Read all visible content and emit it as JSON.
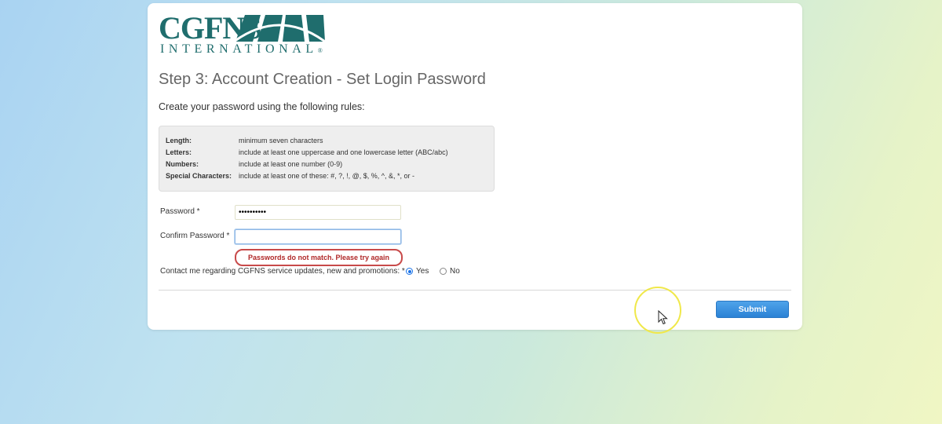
{
  "logo": {
    "text": "CGFNS",
    "subtext": "INTERNATIONAL",
    "registered": "®",
    "color": "#1f6d6d"
  },
  "page": {
    "title": "Step 3: Account Creation - Set Login Password",
    "intro": "Create your password using the following rules:"
  },
  "rules": [
    {
      "label": "Length:",
      "value": "minimum seven characters"
    },
    {
      "label": "Letters:",
      "value": "include at least one uppercase and one lowercase letter (ABC/abc)"
    },
    {
      "label": "Numbers:",
      "value": "include at least one number (0-9)"
    },
    {
      "label": "Special Characters:",
      "value": "include at least one of these: #, ?, !, @, $, %, ^, &, *, or -"
    }
  ],
  "form": {
    "password_label": "Password *",
    "password_value": "••••••••••",
    "confirm_label": "Confirm Password *",
    "confirm_value": "",
    "error_message": "Passwords do not match. Please try again",
    "contact_label": "Contact me regarding CGFNS service updates, new and promotions: *",
    "contact_options": [
      {
        "label": "Yes",
        "selected": true
      },
      {
        "label": "No",
        "selected": false
      }
    ]
  },
  "actions": {
    "submit_label": "Submit"
  },
  "colors": {
    "accent": "#2b82d5",
    "error": "#b02828",
    "cursor_highlight": "#f0e84a"
  }
}
